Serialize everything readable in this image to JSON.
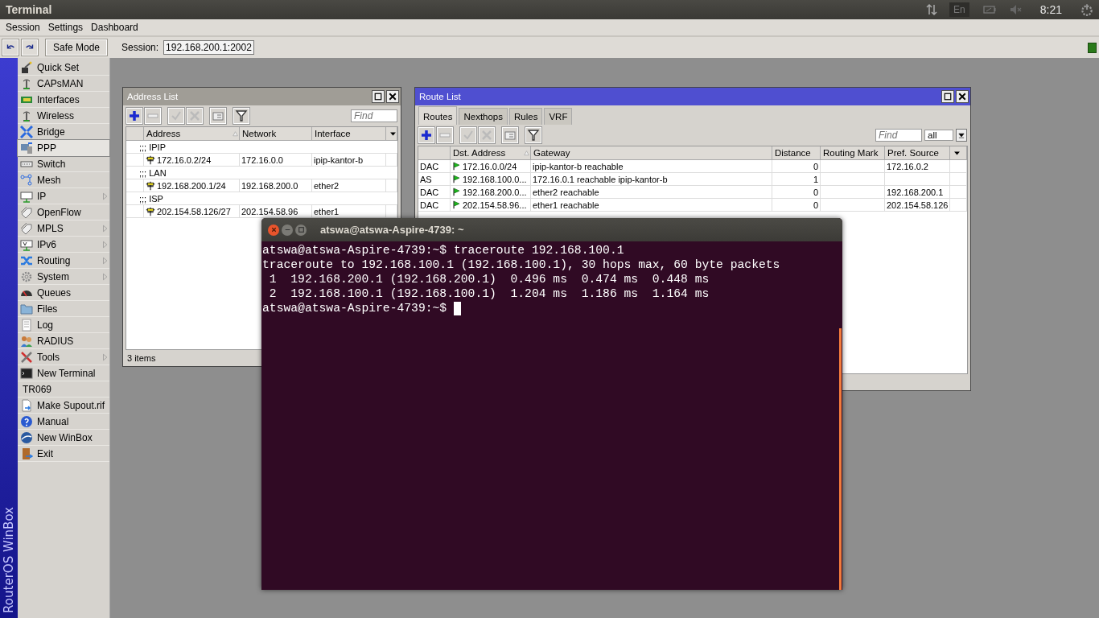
{
  "top_panel": {
    "title": "Terminal",
    "keyboard": "En",
    "clock": "8:21"
  },
  "menu": [
    "Session",
    "Settings",
    "Dashboard"
  ],
  "toolbar": {
    "safe_mode": "Safe Mode",
    "session_label": "Session:",
    "session_value": "192.168.200.1:2002"
  },
  "brand": "RouterOS WinBox",
  "sidebar": {
    "items": [
      {
        "label": "Quick Set",
        "kind": "wand",
        "submenu": false,
        "selected": false
      },
      {
        "label": "CAPsMAN",
        "kind": "antenna",
        "submenu": false,
        "selected": false
      },
      {
        "label": "Interfaces",
        "kind": "card",
        "submenu": false,
        "selected": false
      },
      {
        "label": "Wireless",
        "kind": "antenna",
        "submenu": false,
        "selected": false
      },
      {
        "label": "Bridge",
        "kind": "bridge",
        "submenu": false,
        "selected": false
      },
      {
        "label": "PPP",
        "kind": "computer",
        "submenu": false,
        "selected": true
      },
      {
        "label": "Switch",
        "kind": "switch",
        "submenu": false,
        "selected": false
      },
      {
        "label": "Mesh",
        "kind": "mesh",
        "submenu": false,
        "selected": false
      },
      {
        "label": "IP",
        "kind": "ip",
        "submenu": true,
        "selected": false
      },
      {
        "label": "OpenFlow",
        "kind": "tag",
        "submenu": false,
        "selected": false
      },
      {
        "label": "MPLS",
        "kind": "tag",
        "submenu": true,
        "selected": false
      },
      {
        "label": "IPv6",
        "kind": "ipv6",
        "submenu": true,
        "selected": false
      },
      {
        "label": "Routing",
        "kind": "shuffle",
        "submenu": true,
        "selected": false
      },
      {
        "label": "System",
        "kind": "gear",
        "submenu": true,
        "selected": false
      },
      {
        "label": "Queues",
        "kind": "gauge",
        "submenu": false,
        "selected": false
      },
      {
        "label": "Files",
        "kind": "folder",
        "submenu": false,
        "selected": false
      },
      {
        "label": "Log",
        "kind": "doc",
        "submenu": false,
        "selected": false
      },
      {
        "label": "RADIUS",
        "kind": "people",
        "submenu": false,
        "selected": false
      },
      {
        "label": "Tools",
        "kind": "tools",
        "submenu": true,
        "selected": false
      },
      {
        "label": "New Terminal",
        "kind": "terminal",
        "submenu": false,
        "selected": false
      },
      {
        "label": "TR069",
        "kind": "none",
        "submenu": false,
        "selected": false
      },
      {
        "label": "Make Supout.rif",
        "kind": "file",
        "submenu": false,
        "selected": false
      },
      {
        "label": "Manual",
        "kind": "help",
        "submenu": false,
        "selected": false
      },
      {
        "label": "New WinBox",
        "kind": "globe",
        "submenu": false,
        "selected": false
      },
      {
        "label": "Exit",
        "kind": "door",
        "submenu": false,
        "selected": false
      }
    ]
  },
  "address_list": {
    "title": "Address List",
    "active": false,
    "find_placeholder": "Find",
    "columns": [
      {
        "label": "Address",
        "sorted": true
      },
      {
        "label": "Network",
        "sorted": false
      },
      {
        "label": "Interface",
        "sorted": false
      }
    ],
    "rows": [
      {
        "kind": "comment",
        "text": ";;; IPIP"
      },
      {
        "kind": "entry",
        "address": "172.16.0.2/24",
        "network": "172.16.0.0",
        "interface": "ipip-kantor-b"
      },
      {
        "kind": "comment",
        "text": ";;; LAN"
      },
      {
        "kind": "entry",
        "address": "192.168.200.1/24",
        "network": "192.168.200.0",
        "interface": "ether2"
      },
      {
        "kind": "comment",
        "text": ";;; ISP"
      },
      {
        "kind": "entry",
        "address": "202.154.58.126/27",
        "network": "202.154.58.96",
        "interface": "ether1"
      }
    ],
    "status": "3 items"
  },
  "route_list": {
    "title": "Route List",
    "active": true,
    "tabs": [
      {
        "label": "Routes",
        "selected": true
      },
      {
        "label": "Nexthops",
        "selected": false
      },
      {
        "label": "Rules",
        "selected": false
      },
      {
        "label": "VRF",
        "selected": false
      }
    ],
    "find_placeholder": "Find",
    "filter": "all",
    "columns": [
      {
        "label": "Dst. Address",
        "sorted": true
      },
      {
        "label": "Gateway",
        "sorted": false
      },
      {
        "label": "Distance",
        "sorted": false
      },
      {
        "label": "Routing Mark",
        "sorted": false
      },
      {
        "label": "Pref. Source",
        "sorted": false
      }
    ],
    "rows": [
      {
        "column_1": "DAC",
        "dst_address": "172.16.0.0/24",
        "gateway": "ipip-kantor-b reachable",
        "distance": "0",
        "pref_source": "172.16.0.2"
      },
      {
        "column_1": "AS",
        "dst_address": "192.168.100.0...",
        "gateway": "172.16.0.1 reachable ipip-kantor-b",
        "distance": "1"
      },
      {
        "column_1": "DAC",
        "dst_address": "192.168.200.0...",
        "gateway": "ether2 reachable",
        "distance": "0",
        "pref_source": "192.168.200.1"
      },
      {
        "column_1": "DAC",
        "dst_address": "202.154.58.96...",
        "gateway": "ether1 reachable",
        "distance": "0",
        "pref_source": "202.154.58.126"
      }
    ]
  },
  "terminal": {
    "title": "atswa@atswa-Aspire-4739: ~",
    "cursor": true,
    "lines": [
      "atswa@atswa-Aspire-4739:~$ traceroute 192.168.100.1",
      "traceroute to 192.168.100.1 (192.168.100.1), 30 hops max, 60 byte packets",
      " 1  192.168.200.1 (192.168.200.1)  0.496 ms  0.474 ms  0.448 ms",
      " 2  192.168.100.1 (192.168.100.1)  1.204 ms  1.186 ms  1.164 ms",
      "atswa@atswa-Aspire-4739:~$ "
    ]
  }
}
